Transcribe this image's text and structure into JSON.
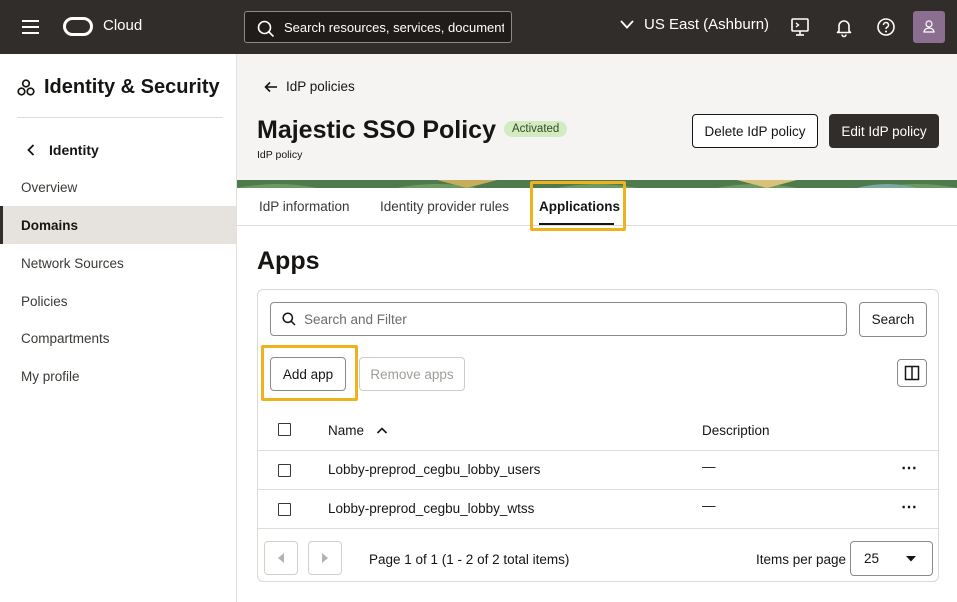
{
  "topbar": {
    "brand": "Cloud",
    "search_placeholder": "Search resources, services, documentation, and Marketplace",
    "region": "US East (Ashburn)",
    "icons": [
      "menu-icon",
      "oracle-logo",
      "search-icon",
      "chevron-down-icon",
      "cloud-shell-icon",
      "bell-icon",
      "help-icon",
      "user-avatar"
    ]
  },
  "sidebar": {
    "title": "Identity & Security",
    "back_label": "Identity",
    "items": [
      {
        "label": "Overview",
        "active": false
      },
      {
        "label": "Domains",
        "active": true
      },
      {
        "label": "Network Sources",
        "active": false
      },
      {
        "label": "Policies",
        "active": false
      },
      {
        "label": "Compartments",
        "active": false
      },
      {
        "label": "My profile",
        "active": false
      }
    ]
  },
  "header": {
    "back_label": "IdP policies",
    "title": "Majestic SSO Policy",
    "status": "Activated",
    "subtitle": "IdP policy",
    "delete_button": "Delete IdP policy",
    "edit_button": "Edit IdP policy"
  },
  "tabs": [
    {
      "label": "IdP information",
      "active": false
    },
    {
      "label": "Identity provider rules",
      "active": false
    },
    {
      "label": "Applications",
      "active": true
    }
  ],
  "apps": {
    "title": "Apps",
    "filter_placeholder": "Search and Filter",
    "search_button": "Search",
    "add_button": "Add app",
    "remove_button": "Remove apps",
    "columns": {
      "name": "Name",
      "description": "Description"
    },
    "rows": [
      {
        "name": "Lobby-preprod_cegbu_lobby_users",
        "description": "—"
      },
      {
        "name": "Lobby-preprod_cegbu_lobby_wtss",
        "description": "—"
      }
    ],
    "pagination": {
      "text": "Page 1 of 1 (1 - 2 of 2 total items)",
      "items_per_page_label": "Items per page",
      "items_per_page": "25"
    }
  },
  "colors": {
    "topbar": "#312d2a",
    "highlight": "#efb21c",
    "badge_bg": "#d3ebc3",
    "primary_button": "#312d2a"
  }
}
